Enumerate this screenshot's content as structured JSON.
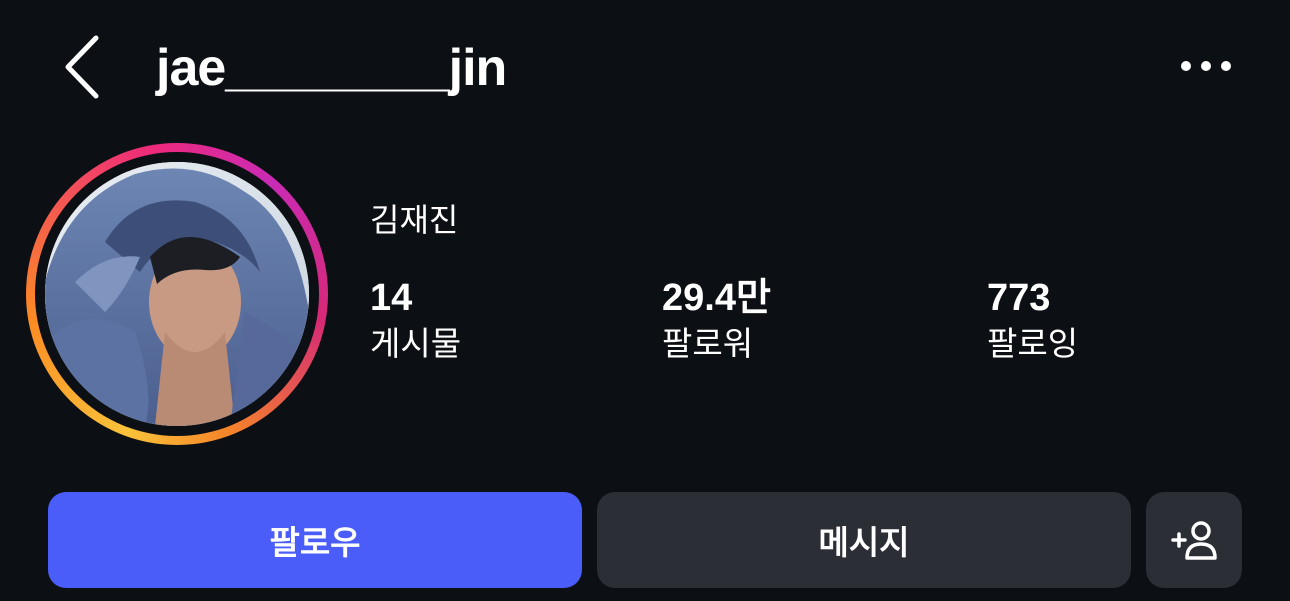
{
  "header": {
    "username": "jae________jin",
    "back_icon": "chevron-left-icon",
    "more_icon": "more-horizontal-icon"
  },
  "profile": {
    "display_name": "김재진",
    "avatar_story_ring": true,
    "stats": [
      {
        "count": "14",
        "label": "게시물"
      },
      {
        "count": "29.4만",
        "label": "팔로워"
      },
      {
        "count": "773",
        "label": "팔로잉"
      }
    ]
  },
  "actions": {
    "follow_label": "팔로우",
    "message_label": "메시지",
    "add_user_icon": "person-add-icon"
  },
  "colors": {
    "background": "#0c0f14",
    "follow_button": "#4a5df9",
    "secondary_button": "#2b2e35",
    "text": "#ffffff"
  }
}
